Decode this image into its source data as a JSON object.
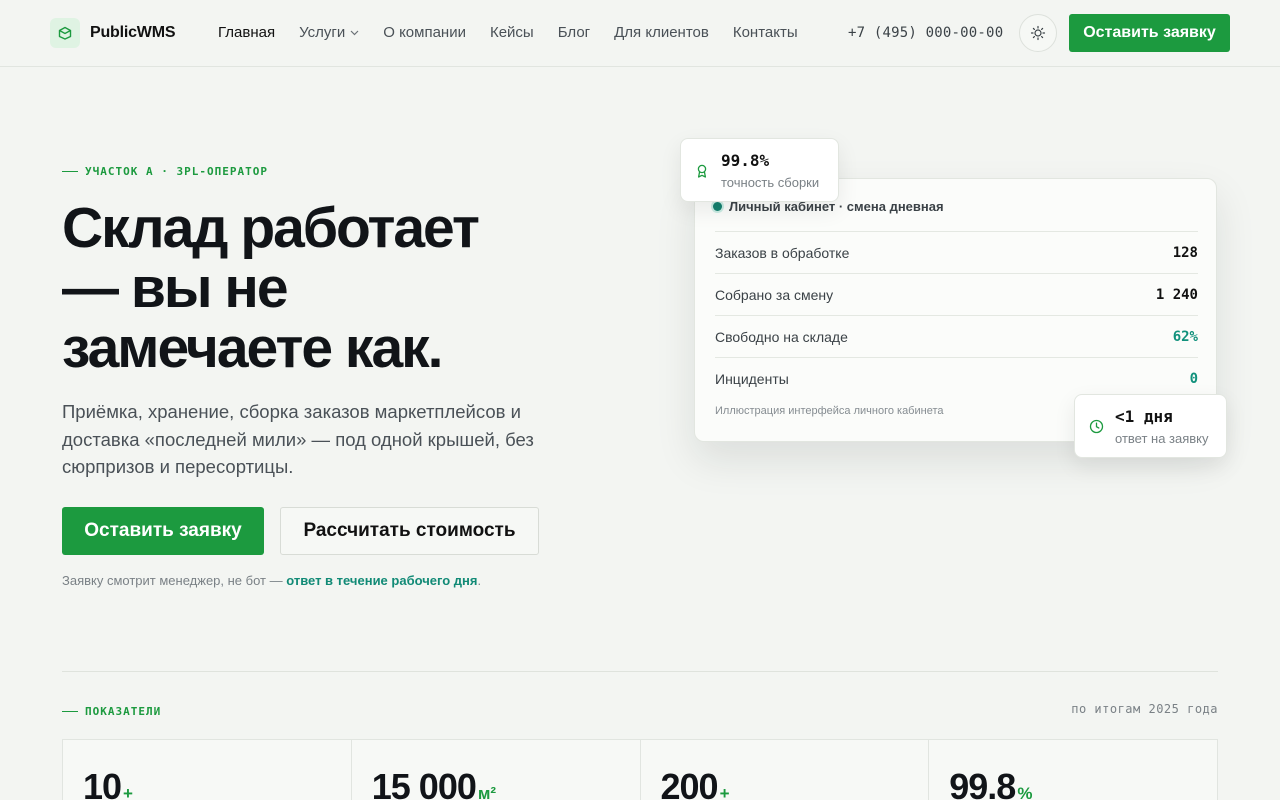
{
  "header": {
    "brand": "PublicWMS",
    "nav": [
      {
        "label": "Главная",
        "active": true
      },
      {
        "label": "Услуги",
        "dropdown": true
      },
      {
        "label": "О компании"
      },
      {
        "label": "Кейсы"
      },
      {
        "label": "Блог"
      },
      {
        "label": "Для клиентов"
      },
      {
        "label": "Контакты"
      }
    ],
    "phone": "+7 (495) 000-00-00",
    "cta_label": "Оставить заявку"
  },
  "hero": {
    "eyebrow": "УЧАСТОК А · 3PL-ОПЕРАТОР",
    "title_line1": "Склад работает",
    "title_line2": "— вы не",
    "title_line3": "замечаете как.",
    "subtitle": "Приёмка, хранение, сборка заказов маркетплейсов и доставка «последней мили» — под одной крышей, без сюрпризов и пересортицы.",
    "cta_primary": "Оставить заявку",
    "cta_secondary": "Рассчитать стоимость",
    "note_text": "Заявку смотрит менеджер, не бот — ",
    "note_link": "ответ в течение рабочего дня",
    "note_end": "."
  },
  "dashboard": {
    "title": "Личный кабинет · смена дневная",
    "rows": [
      {
        "label": "Заказов в обработке",
        "value": "128"
      },
      {
        "label": "Собрано за смену",
        "value": "1 240"
      },
      {
        "label": "Свободно на складе",
        "value": "62%"
      },
      {
        "label": "Инциденты",
        "value": "0"
      }
    ],
    "footnote": "Иллюстрация интерфейса личного кабинета"
  },
  "badges": {
    "accuracy": {
      "value": "99.8%",
      "label": "точность сборки"
    },
    "response": {
      "value": "<1 дня",
      "label": "ответ на заявку"
    }
  },
  "stats": {
    "eyebrow": "ПОКАЗАТЕЛИ",
    "period": "по итогам 2025 года",
    "items": [
      {
        "value": "10",
        "unit": "+"
      },
      {
        "value": "15 000",
        "unit": "м²"
      },
      {
        "value": "200",
        "unit": "+"
      },
      {
        "value": "99.8",
        "unit": "%"
      }
    ]
  },
  "colors": {
    "accent": "#1c9a3f",
    "teal": "#11917c",
    "background": "#f3f5f2"
  }
}
